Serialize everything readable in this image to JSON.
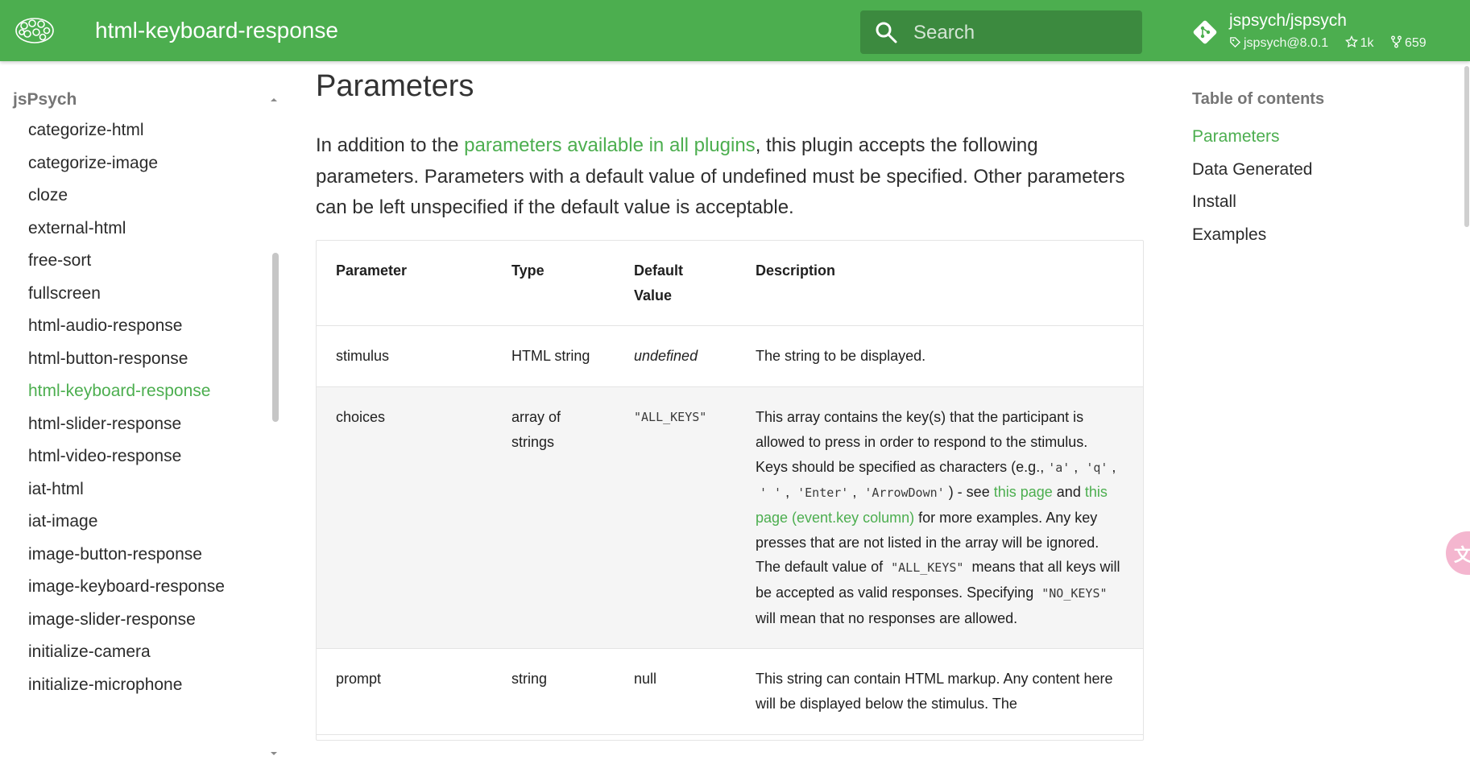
{
  "header": {
    "title": "html-keyboard-response",
    "search_placeholder": "Search",
    "repo": {
      "name": "jspsych/jspsych",
      "version": "jspsych@8.0.1",
      "stars": "1k",
      "forks": "659"
    }
  },
  "sidebar": {
    "heading": "jsPsych",
    "items": [
      "categorize-html",
      "categorize-image",
      "cloze",
      "external-html",
      "free-sort",
      "fullscreen",
      "html-audio-response",
      "html-button-response",
      "html-keyboard-response",
      "html-slider-response",
      "html-video-response",
      "iat-html",
      "iat-image",
      "image-button-response",
      "image-keyboard-response",
      "image-slider-response",
      "initialize-camera",
      "initialize-microphone"
    ],
    "active_item": "html-keyboard-response"
  },
  "main": {
    "heading": "Parameters",
    "intro": {
      "before_link": "In addition to the ",
      "link": "parameters available in all plugins",
      "after_link": ", this plugin accepts the following parameters. Parameters with a default value of undefined must be specified. Other parameters can be left unspecified if the default value is acceptable."
    },
    "table": {
      "headers": [
        "Parameter",
        "Type",
        "Default Value",
        "Description"
      ],
      "rows": [
        {
          "parameter": "stimulus",
          "type": "HTML string",
          "default": "undefined",
          "description": "The string to be displayed."
        },
        {
          "parameter": "choices",
          "type": "array of strings",
          "default": "\"ALL_KEYS\"",
          "description": {
            "p1": "This array contains the key(s) that the participant is allowed to press in order to respond to the stimulus. Keys should be specified as characters (e.g.,",
            "code_a": "'a'",
            "code_q": "'q'",
            "code_space": "' '",
            "code_enter": "'Enter'",
            "code_arrow": "'ArrowDown'",
            "p2": ") - see",
            "link1": "this page",
            "p3": "and",
            "link2": "this page (event.key column)",
            "p4": "for more examples. Any key presses that are not listed in the array will be ignored. The default value of",
            "code_all": "\"ALL_KEYS\"",
            "p5": "means that all keys will be accepted as valid responses. Specifying",
            "code_no": "\"NO_KEYS\"",
            "p6": "will mean that no responses are allowed."
          }
        },
        {
          "parameter": "prompt",
          "type": "string",
          "default": "null",
          "description": "This string can contain HTML markup. Any content here will be displayed below the stimulus. The"
        }
      ]
    }
  },
  "toc": {
    "heading": "Table of contents",
    "items": [
      "Parameters",
      "Data Generated",
      "Install",
      "Examples"
    ],
    "active_item": "Parameters"
  },
  "widgets": {
    "translate_label": "文A"
  },
  "colors": {
    "brand_green": "#4cae4f",
    "search_bg": "#3c8a3f",
    "link": "#4cae4f"
  }
}
